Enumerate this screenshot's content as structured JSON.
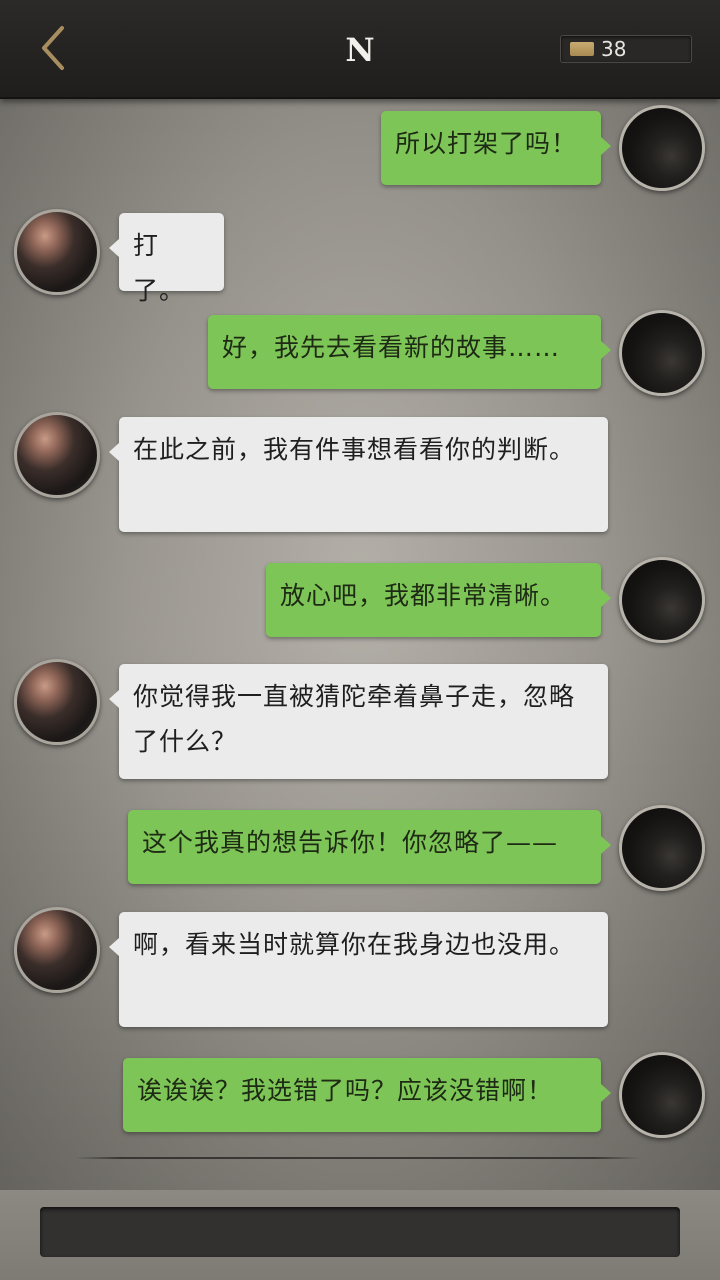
{
  "header": {
    "title": "N",
    "coin_count": "38"
  },
  "messages": [
    {
      "sender": "me",
      "text": "所以打架了吗！"
    },
    {
      "sender": "them",
      "text": "打了。"
    },
    {
      "sender": "me",
      "text": "好，我先去看看新的故事……"
    },
    {
      "sender": "them",
      "text": "在此之前，我有件事想看看你的判断。"
    },
    {
      "sender": "me",
      "text": "放心吧，我都非常清晰。"
    },
    {
      "sender": "them",
      "text": "你觉得我一直被猜陀牵着鼻子走，忽略了什么？"
    },
    {
      "sender": "me",
      "text": "这个我真的想告诉你！你忽略了——"
    },
    {
      "sender": "them",
      "text": "啊，看来当时就算你在我身边也没用。"
    },
    {
      "sender": "me",
      "text": "诶诶诶？我选错了吗？应该没错啊！"
    }
  ],
  "input": {
    "placeholder": ""
  },
  "colors": {
    "my_bubble": "#7ec557",
    "their_bubble": "#ebebeb",
    "header_bg": "#1f1e1c"
  },
  "icons": {
    "back": "chevron-left-icon",
    "coin": "coin-icon"
  }
}
